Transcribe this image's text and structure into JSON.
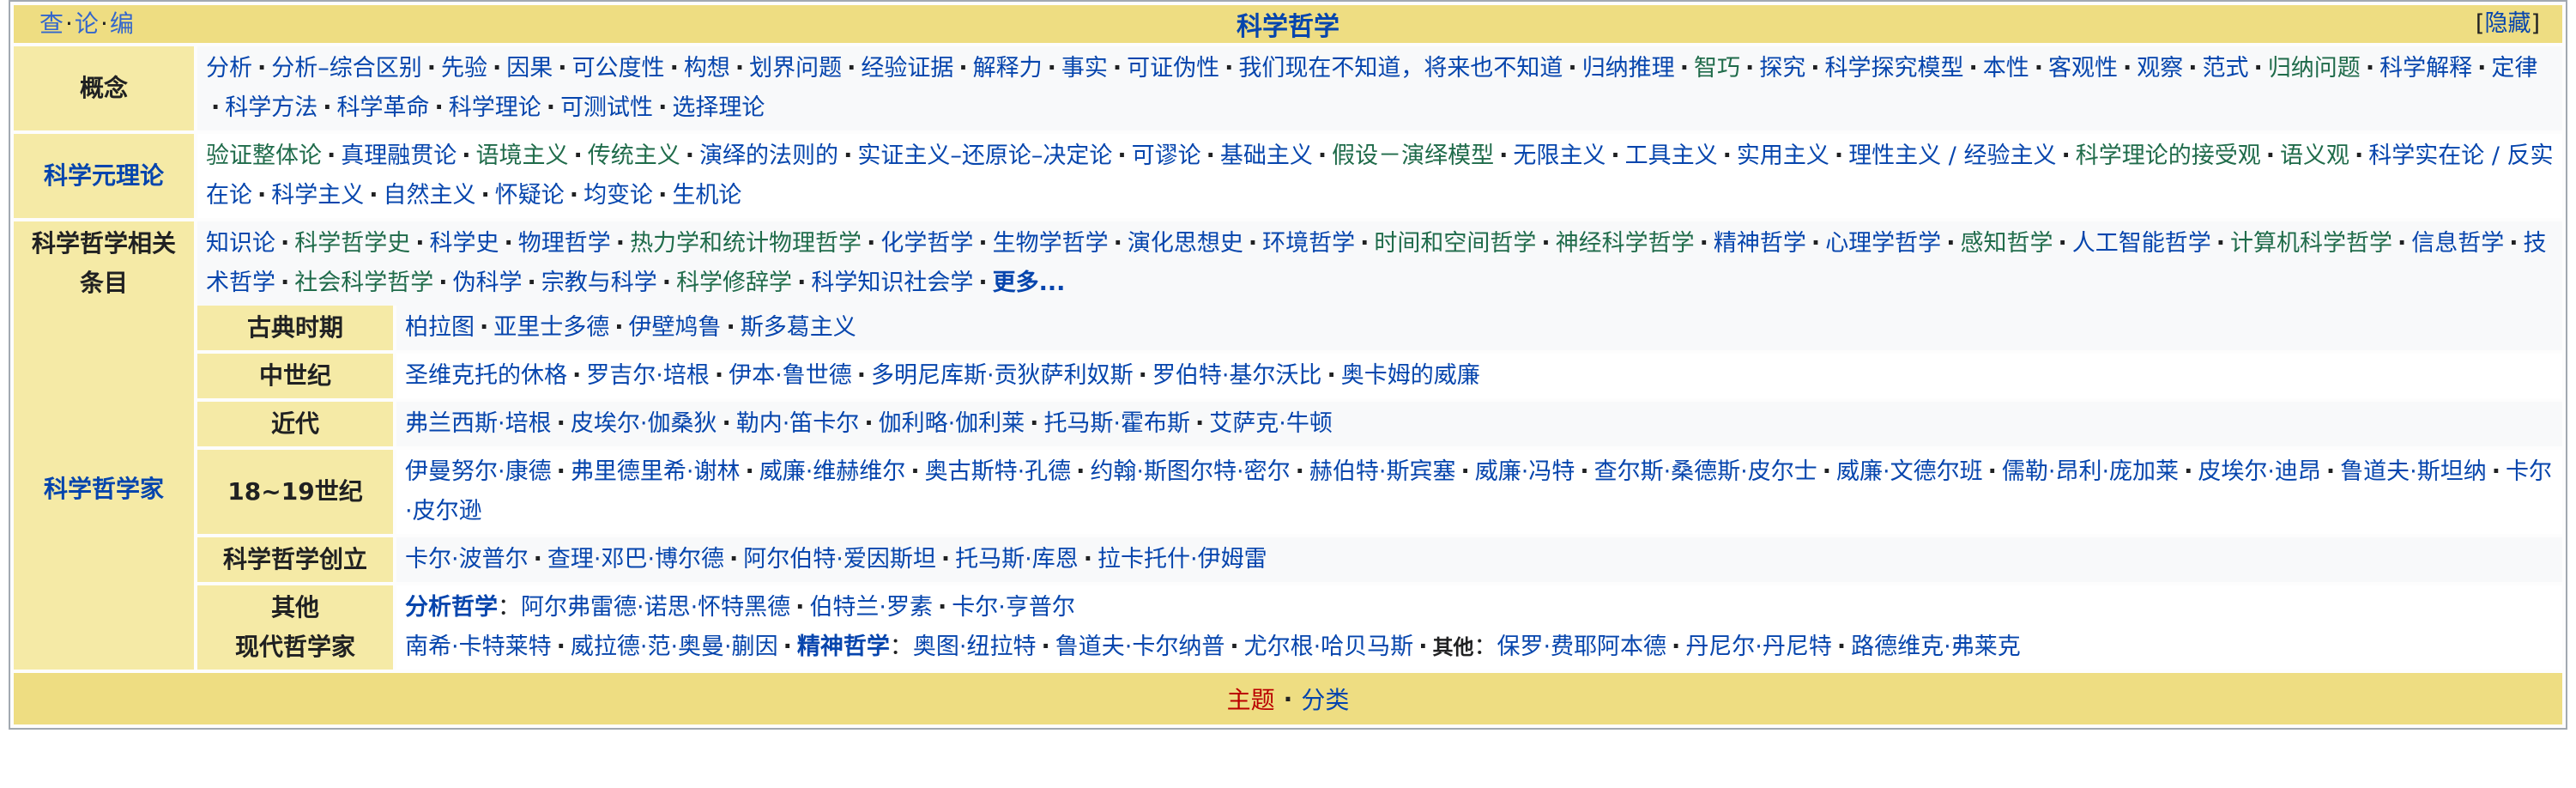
{
  "titlebar": {
    "vte": [
      "查",
      "论",
      "编"
    ],
    "title": "科学哲学",
    "hide": [
      "[",
      "隐藏",
      "]"
    ]
  },
  "rows": [
    {
      "label": "概念",
      "label_color": "black",
      "items": [
        {
          "t": "分析"
        },
        {
          "t": "分析–综合区别"
        },
        {
          "t": "先验"
        },
        {
          "t": "因果"
        },
        {
          "t": "可公度性"
        },
        {
          "t": "构想"
        },
        {
          "t": "划界问题"
        },
        {
          "t": "经验证据"
        },
        {
          "t": "解释力"
        },
        {
          "t": "事实"
        },
        {
          "t": "可证伪性"
        },
        {
          "t": "我们现在不知道，将来也不知道"
        },
        {
          "t": "归纳推理"
        },
        {
          "t": "智巧",
          "g": true
        },
        {
          "t": "探究"
        },
        {
          "t": "科学探究模型"
        },
        {
          "t": "本性"
        },
        {
          "t": "客观性"
        },
        {
          "t": "观察"
        },
        {
          "t": "范式"
        },
        {
          "t": "归纳问题",
          "g": true
        },
        {
          "t": "科学解释"
        },
        {
          "t": "定律"
        },
        {
          "t": "科学方法"
        },
        {
          "t": "科学革命"
        },
        {
          "t": "科学理论"
        },
        {
          "t": "可测试性"
        },
        {
          "t": "选择理论"
        }
      ]
    },
    {
      "label": "科学元理论",
      "label_color": "blue",
      "items": [
        {
          "t": "验证整体论",
          "g": true
        },
        {
          "t": "真理融贯论"
        },
        {
          "t": "语境主义",
          "g": true
        },
        {
          "t": "传统主义",
          "g": true
        },
        {
          "t": "演绎的法则的"
        },
        {
          "t": "实证主义–还原论–决定论"
        },
        {
          "t": "可谬论"
        },
        {
          "t": "基础主义"
        },
        {
          "t": "假设－演绎模型",
          "g": true
        },
        {
          "t": "无限主义"
        },
        {
          "t": "工具主义"
        },
        {
          "t": "实用主义"
        },
        {
          "t": "理性主义 / 经验主义"
        },
        {
          "t": "科学理论的接受观",
          "g": true
        },
        {
          "t": "语义观",
          "g": true
        },
        {
          "t": "科学实在论 / 反实在论"
        },
        {
          "t": "科学主义"
        },
        {
          "t": "自然主义"
        },
        {
          "t": "怀疑论"
        },
        {
          "t": "均变论"
        },
        {
          "t": "生机论"
        }
      ]
    },
    {
      "label": "科学哲学相关条目",
      "label_color": "black",
      "items": [
        {
          "t": "知识论"
        },
        {
          "t": "科学哲学史",
          "g": true
        },
        {
          "t": "科学史"
        },
        {
          "t": "物理哲学"
        },
        {
          "t": "热力学和统计物理哲学",
          "g": true
        },
        {
          "t": "化学哲学"
        },
        {
          "t": "生物学哲学"
        },
        {
          "t": "演化思想史"
        },
        {
          "t": "环境哲学"
        },
        {
          "t": "时间和空间哲学",
          "g": true
        },
        {
          "t": "神经科学哲学",
          "g": true
        },
        {
          "t": "精神哲学"
        },
        {
          "t": "心理学哲学"
        },
        {
          "t": "感知哲学",
          "g": true
        },
        {
          "t": "人工智能哲学"
        },
        {
          "t": "计算机科学哲学",
          "g": true
        },
        {
          "t": "信息哲学"
        },
        {
          "t": "技术哲学"
        },
        {
          "t": "社会科学哲学",
          "g": true
        },
        {
          "t": "伪科学"
        },
        {
          "t": "宗教与科学"
        },
        {
          "t": "科学修辞学",
          "g": true
        },
        {
          "t": "科学知识社会学"
        },
        {
          "t": "更多...",
          "b": true
        }
      ]
    }
  ],
  "philosophers": {
    "label": "科学哲学家",
    "subrows": [
      {
        "label": "古典时期",
        "items": [
          "柏拉图",
          "亚里士多德",
          "伊壁鸠鲁",
          "斯多葛主义"
        ]
      },
      {
        "label": "中世纪",
        "items": [
          "圣维克托的休格",
          "罗吉尔·培根",
          "伊本·鲁世德",
          "多明尼库斯·贡狄萨利奴斯",
          "罗伯特·基尔沃比",
          "奥卡姆的威廉"
        ]
      },
      {
        "label": "近代",
        "items": [
          "弗兰西斯·培根",
          "皮埃尔·伽桑狄",
          "勒内·笛卡尔",
          "伽利略·伽利莱",
          "托马斯·霍布斯",
          "艾萨克·牛顿"
        ]
      },
      {
        "label": "18~19世纪",
        "items": [
          "伊曼努尔·康德",
          "弗里德里希·谢林",
          "威廉·维赫维尔",
          "奥古斯特·孔德",
          "约翰·斯图尔特·密尔",
          "赫伯特·斯宾塞",
          "威廉·冯特",
          "查尔斯·桑德斯·皮尔士",
          "威廉·文德尔班",
          "儒勒·昂利·庞加莱",
          "皮埃尔·迪昂",
          "鲁道夫·斯坦纳",
          "卡尔·皮尔逊"
        ]
      },
      {
        "label": "科学哲学创立",
        "items": [
          "卡尔·波普尔",
          "查理·邓巴·博尔德",
          "阿尔伯特·爱因斯坦",
          "托马斯·库恩",
          "拉卡托什·伊姆雷"
        ]
      }
    ],
    "modern": {
      "label_line1": "其他",
      "label_line2": "现代哲学家",
      "line1_head": "分析哲学",
      "line1_items": [
        "阿尔弗雷德·诺思·怀特黑德",
        "伯特兰·罗素",
        "卡尔·亨普尔"
      ],
      "line2_pre": [
        "南希·卡特莱特",
        "威拉德·范·奥曼·蒯因"
      ],
      "line2_head": "精神哲学",
      "line2_mid": [
        "奥图·纽拉特",
        "鲁道夫·卡尔纳普",
        "尤尔根·哈贝马斯"
      ],
      "line2_head2": "其他",
      "line2_post": [
        "保罗·费耶阿本德",
        "丹尼尔·丹尼特",
        "路德维克·弗莱克"
      ]
    }
  },
  "footer": {
    "topic": "主题",
    "category": "分类"
  }
}
